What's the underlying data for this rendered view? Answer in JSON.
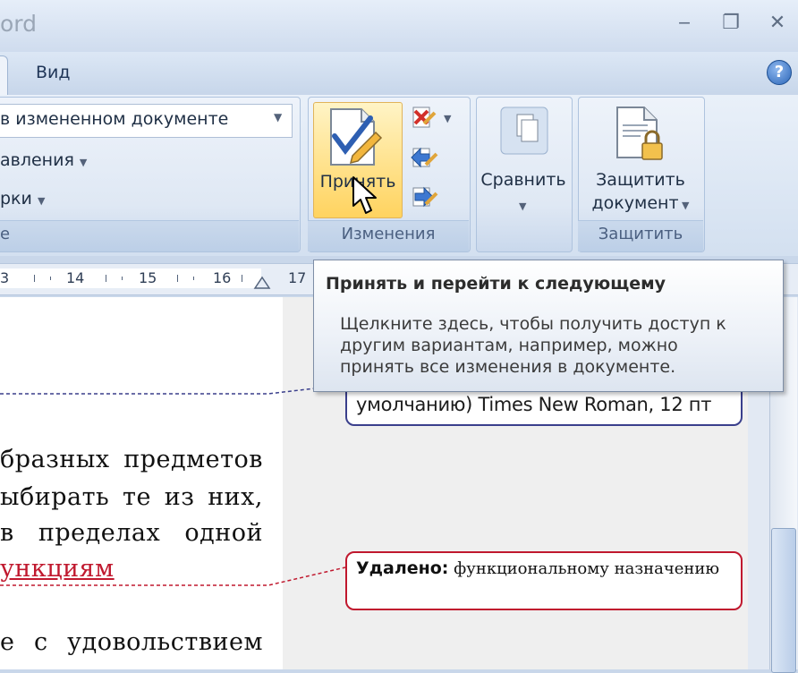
{
  "window": {
    "title_fragment": "ord",
    "minimize_glyph": "‒",
    "restore_glyph": "❐",
    "close_glyph": "✕"
  },
  "tabs": {
    "view_label": "Вид",
    "help_glyph": "?"
  },
  "ribbon": {
    "tracking_group": {
      "display_combo_value": "в измененном документе",
      "show_markup_label": "авления",
      "balloons_label": "рки",
      "group_label_fragment": "е"
    },
    "changes_group": {
      "accept_label": "Принять",
      "group_label": "Изменения"
    },
    "compare_group": {
      "compare_label": "Сравнить"
    },
    "protect_group": {
      "protect_label_line1": "Защитить",
      "protect_label_line2": "документ",
      "group_label": "Защитить"
    }
  },
  "ruler": {
    "numbers": [
      "3",
      "14",
      "15",
      "16",
      "17"
    ]
  },
  "document": {
    "lines": [
      "бразных предметов",
      "ыбирать те из них,",
      "в пределах одной",
      "ункциям",
      "е с удовольствием"
    ]
  },
  "balloons": {
    "format_balloon_text": "умолчанию) Times New Roman, 12 пт",
    "deleted_label": "Удалено:",
    "deleted_text": "функциональному назначению"
  },
  "tooltip": {
    "title": "Принять и перейти к следующему",
    "body_lines": [
      "Щелкните здесь, чтобы получить доступ к",
      "другим вариантам, например, можно",
      "принять все изменения в документе."
    ]
  },
  "colors": {
    "deleted_red": "#c0182e",
    "balloon_blue": "#3a3f8c",
    "accept_highlight": "#ffd35f"
  }
}
